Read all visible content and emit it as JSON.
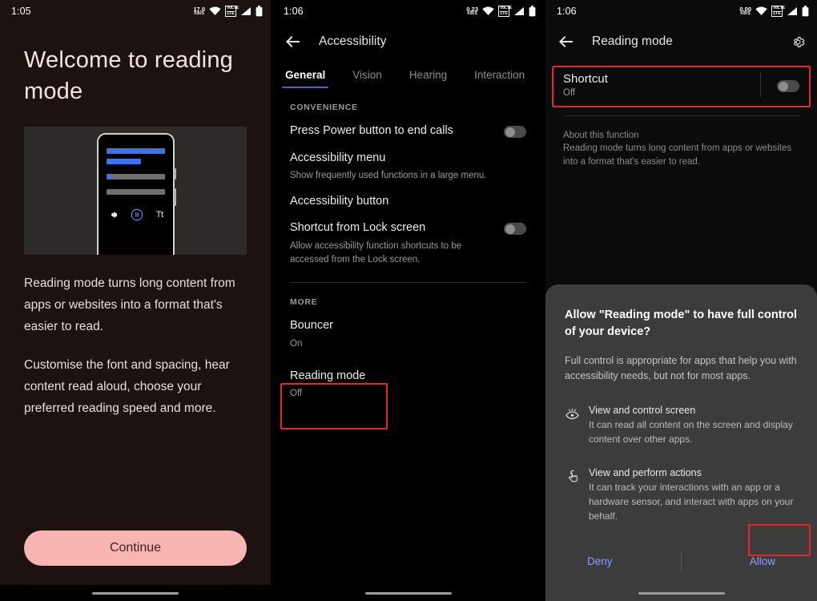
{
  "panel1": {
    "status": {
      "time": "1:05",
      "rate_value": "17.0",
      "rate_unit": "KB/S",
      "volte_top": "VoLTE",
      "volte_bottom": "LTE"
    },
    "heading": "Welcome to reading mode",
    "illustration": {
      "name": "reading-mode-phone-illustration",
      "text_size_icon": "Tt"
    },
    "paragraph1": "Reading mode turns long content from apps or websites into a format that's easier to read.",
    "paragraph2": "Customise the font and spacing, hear content read aloud, choose your preferred reading speed and more.",
    "continue_label": "Continue",
    "accent_pink": "#f8b5b2",
    "background": "#1c1210"
  },
  "panel2": {
    "status": {
      "time": "1:06",
      "rate_value": "0.23",
      "rate_unit": "KB/S",
      "volte_top": "VoLTE",
      "volte_bottom": "LTE"
    },
    "title": "Accessibility",
    "tabs": [
      {
        "label": "General",
        "active": true
      },
      {
        "label": "Vision",
        "active": false
      },
      {
        "label": "Hearing",
        "active": false
      },
      {
        "label": "Interaction",
        "active": false
      }
    ],
    "section_convenience": "CONVENIENCE",
    "items": [
      {
        "title": "Press Power button to end calls",
        "sub": "",
        "toggle": "off"
      },
      {
        "title": "Accessibility menu",
        "sub": "Show frequently used functions in a large menu.",
        "toggle": "none"
      },
      {
        "title": "Accessibility button",
        "sub": "",
        "toggle": "none"
      },
      {
        "title": "Shortcut from Lock screen",
        "sub": "Allow accessibility function shortcuts to be accessed from the Lock screen.",
        "toggle": "off"
      }
    ],
    "section_more": "MORE",
    "more_items": [
      {
        "title": "Bouncer",
        "sub": "On"
      },
      {
        "title": "Reading mode",
        "sub": "Off"
      }
    ],
    "highlight_color": "#e8232a",
    "tab_accent": "#4d5fd1"
  },
  "panel3": {
    "status": {
      "time": "1:06",
      "rate_value": "0.00",
      "rate_unit": "KB/S",
      "volte_top": "VoLTE",
      "volte_bottom": "LTE"
    },
    "title": "Reading mode",
    "shortcut": {
      "title": "Shortcut",
      "sub": "Off",
      "toggle": "off"
    },
    "about": {
      "heading": "About this function",
      "text": "Reading mode turns long content from apps or websites into a format that's easier to read."
    },
    "dialog": {
      "title": "Allow \"Reading mode\" to have full control of your device?",
      "subtitle": "Full control is appropriate for apps that help you with accessibility needs, but not for most apps.",
      "permissions": [
        {
          "icon": "eye-icon",
          "title": "View and control screen",
          "desc": "It can read all content on the screen and display content over other apps."
        },
        {
          "icon": "tap-gesture-icon",
          "title": "View and perform actions",
          "desc": "It can track your interactions with an app or a hardware sensor, and interact with apps on your behalf."
        }
      ],
      "deny_label": "Deny",
      "allow_label": "Allow",
      "button_color": "#8c9eff"
    },
    "highlight_color": "#e8232a"
  }
}
